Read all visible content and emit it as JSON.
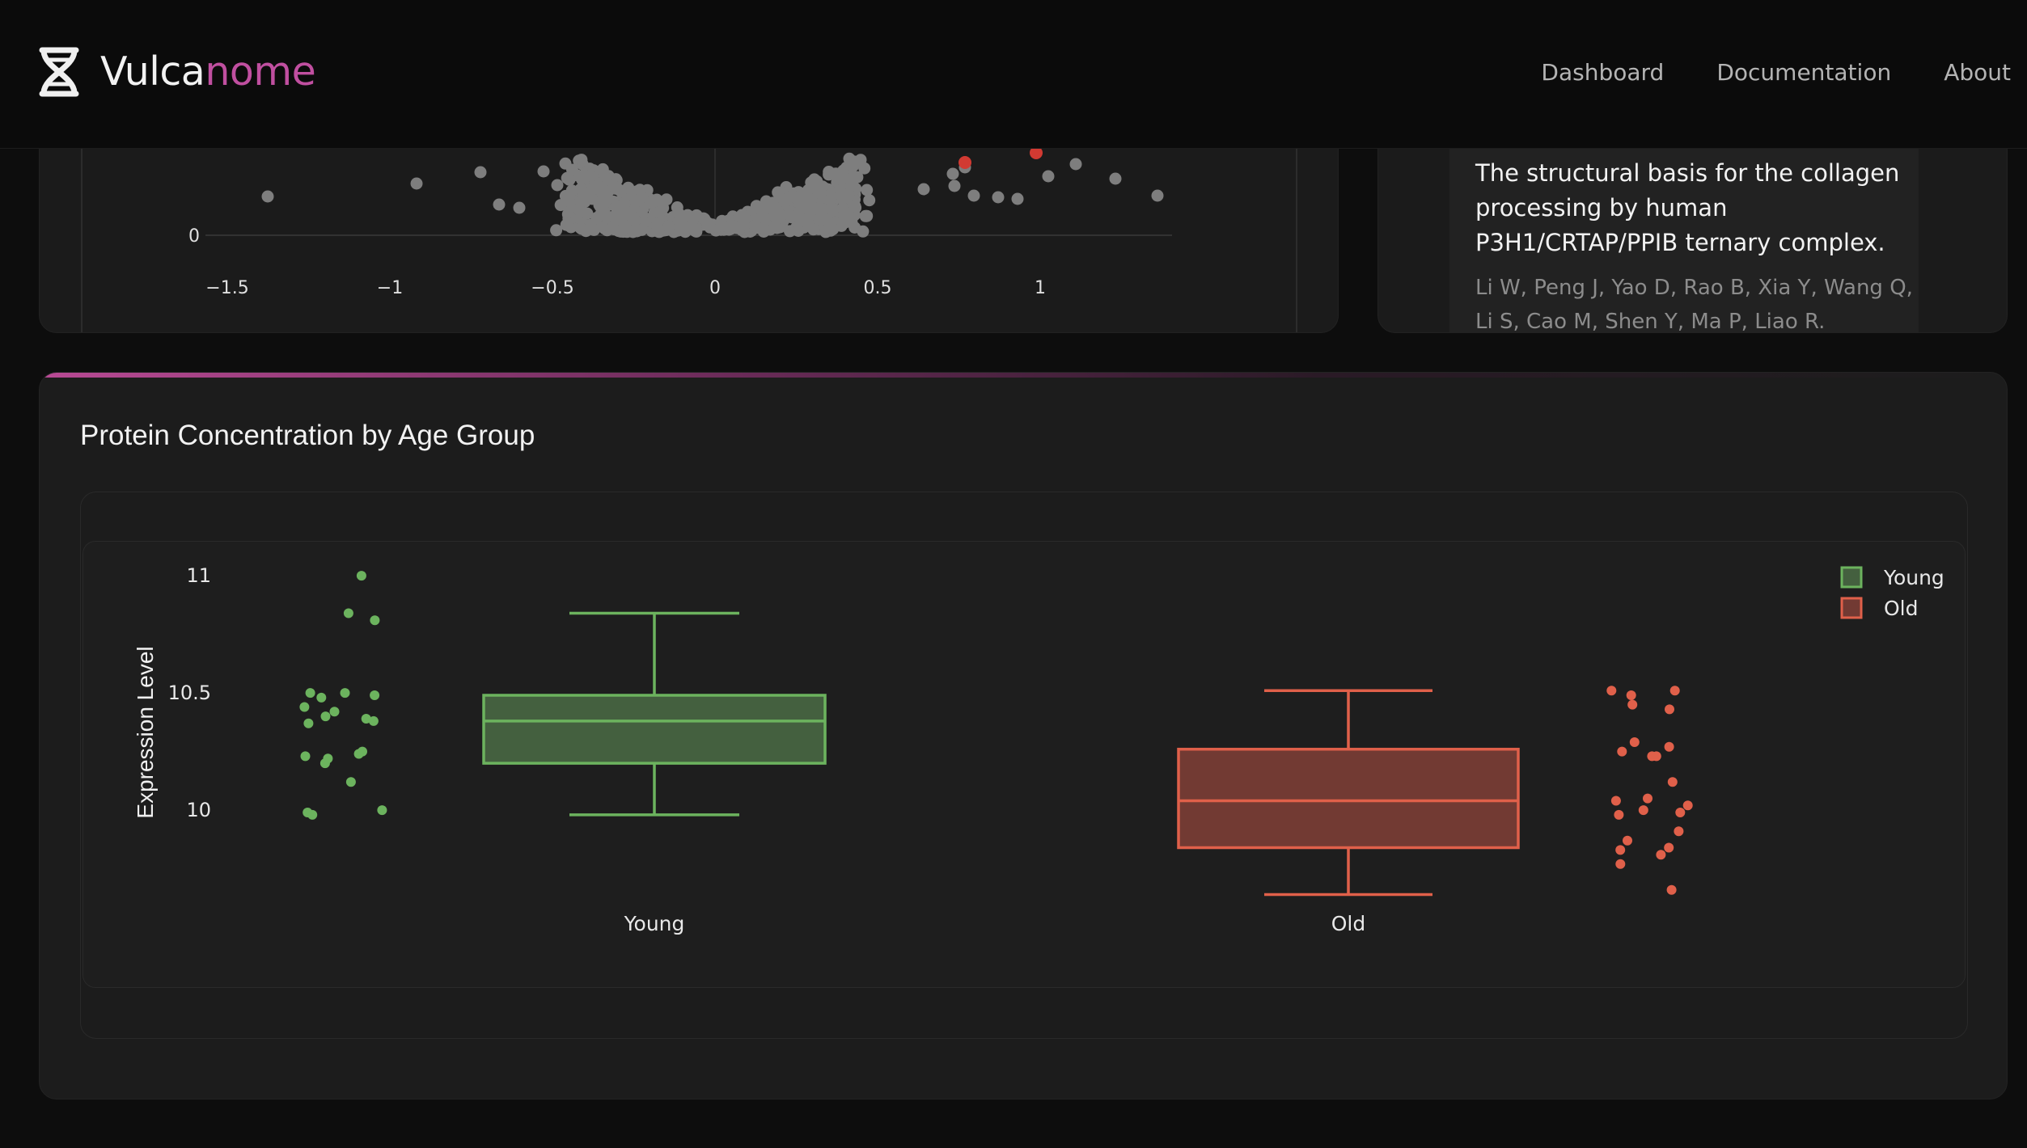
{
  "header": {
    "brand_prefix": "Vulca",
    "brand_suffix": "nome",
    "nav": [
      "Dashboard",
      "Documentation",
      "About"
    ]
  },
  "volcano_card": {
    "x_ticks": [
      "−1.5",
      "−1",
      "−0.5",
      "0",
      "0.5",
      "1"
    ],
    "y_tick": "0"
  },
  "publication": {
    "title": "The structural basis for the collagen processing by human P3H1/CRTAP/PPIB ternary complex.",
    "authors": "Li W, Peng J, Yao D, Rao B, Xia Y, Wang Q, Li S, Cao M, Shen Y, Ma P, Liao R."
  },
  "boxplot_card": {
    "title": "Protein Concentration by Age Group"
  },
  "chart_data": {
    "type": "box",
    "title": "",
    "ylabel": "Expression Level",
    "yticks": [
      "10",
      "10.5",
      "11"
    ],
    "ylim": [
      9.65,
      11.05
    ],
    "legend_placement": "top-right",
    "series": [
      {
        "name": "Young",
        "color": "#6cb35e",
        "fill": "#44603f",
        "whisker_low": 9.98,
        "q1": 10.2,
        "median": 10.38,
        "q3": 10.49,
        "whisker_high": 10.84,
        "points": [
          11.0,
          10.84,
          10.81,
          10.5,
          10.5,
          10.49,
          10.48,
          10.44,
          10.42,
          10.4,
          10.39,
          10.38,
          10.37,
          10.25,
          10.24,
          10.23,
          10.22,
          10.2,
          10.12,
          10.0,
          9.99,
          9.98
        ]
      },
      {
        "name": "Old",
        "color": "#e0604a",
        "fill": "#723a33",
        "whisker_low": 9.64,
        "q1": 9.84,
        "median": 10.04,
        "q3": 10.26,
        "whisker_high": 10.51,
        "points": [
          10.51,
          10.51,
          10.49,
          10.45,
          10.43,
          10.29,
          10.27,
          10.25,
          10.23,
          10.23,
          10.12,
          10.05,
          10.04,
          10.02,
          10.0,
          9.99,
          9.98,
          9.91,
          9.87,
          9.84,
          9.83,
          9.81,
          9.77,
          9.66
        ]
      }
    ]
  }
}
